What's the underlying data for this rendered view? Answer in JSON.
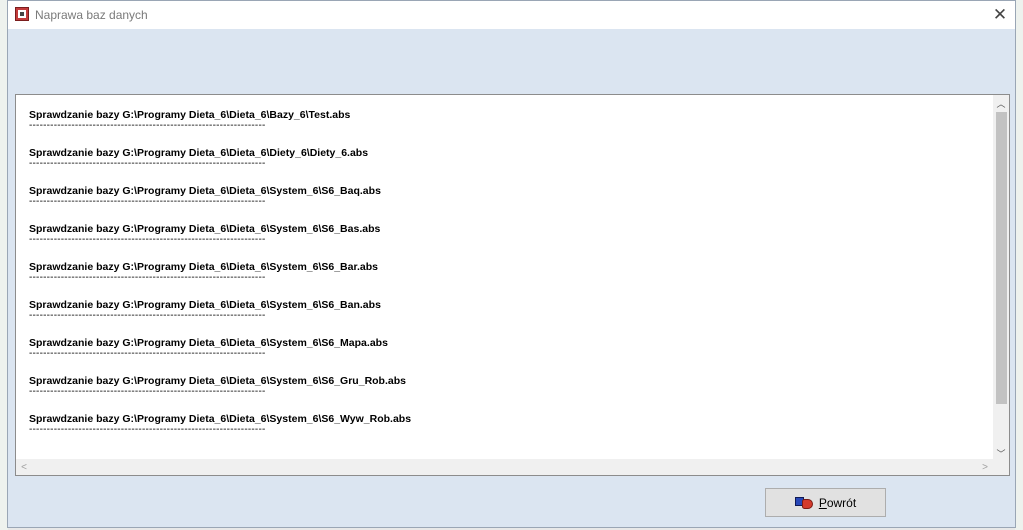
{
  "window": {
    "title": "Naprawa baz danych",
    "close_glyph": "✕"
  },
  "log": {
    "entries": [
      {
        "text": "Sprawdzanie bazy G:\\Programy Dieta_6\\Dieta_6\\Bazy_6\\Test.abs",
        "separator": "-------------------------------------------------------------------"
      },
      {
        "text": "Sprawdzanie bazy G:\\Programy Dieta_6\\Dieta_6\\Diety_6\\Diety_6.abs",
        "separator": "-------------------------------------------------------------------"
      },
      {
        "text": "Sprawdzanie bazy G:\\Programy Dieta_6\\Dieta_6\\System_6\\S6_Baq.abs",
        "separator": "-------------------------------------------------------------------"
      },
      {
        "text": "Sprawdzanie bazy G:\\Programy Dieta_6\\Dieta_6\\System_6\\S6_Bas.abs",
        "separator": "-------------------------------------------------------------------"
      },
      {
        "text": "Sprawdzanie bazy G:\\Programy Dieta_6\\Dieta_6\\System_6\\S6_Bar.abs",
        "separator": "-------------------------------------------------------------------"
      },
      {
        "text": "Sprawdzanie bazy G:\\Programy Dieta_6\\Dieta_6\\System_6\\S6_Ban.abs",
        "separator": "-------------------------------------------------------------------"
      },
      {
        "text": "Sprawdzanie bazy G:\\Programy Dieta_6\\Dieta_6\\System_6\\S6_Mapa.abs",
        "separator": "-------------------------------------------------------------------"
      },
      {
        "text": "Sprawdzanie bazy G:\\Programy Dieta_6\\Dieta_6\\System_6\\S6_Gru_Rob.abs",
        "separator": "-------------------------------------------------------------------"
      },
      {
        "text": "Sprawdzanie bazy G:\\Programy Dieta_6\\Dieta_6\\System_6\\S6_Wyw_Rob.abs",
        "separator": "-------------------------------------------------------------------"
      }
    ]
  },
  "scrollbar": {
    "up_glyph": "︿",
    "down_glyph": "﹀",
    "left_glyph": "<",
    "right_glyph": ">"
  },
  "buttons": {
    "return_first": "P",
    "return_rest": "owrót",
    "return_icon": "return-hand-icon"
  }
}
